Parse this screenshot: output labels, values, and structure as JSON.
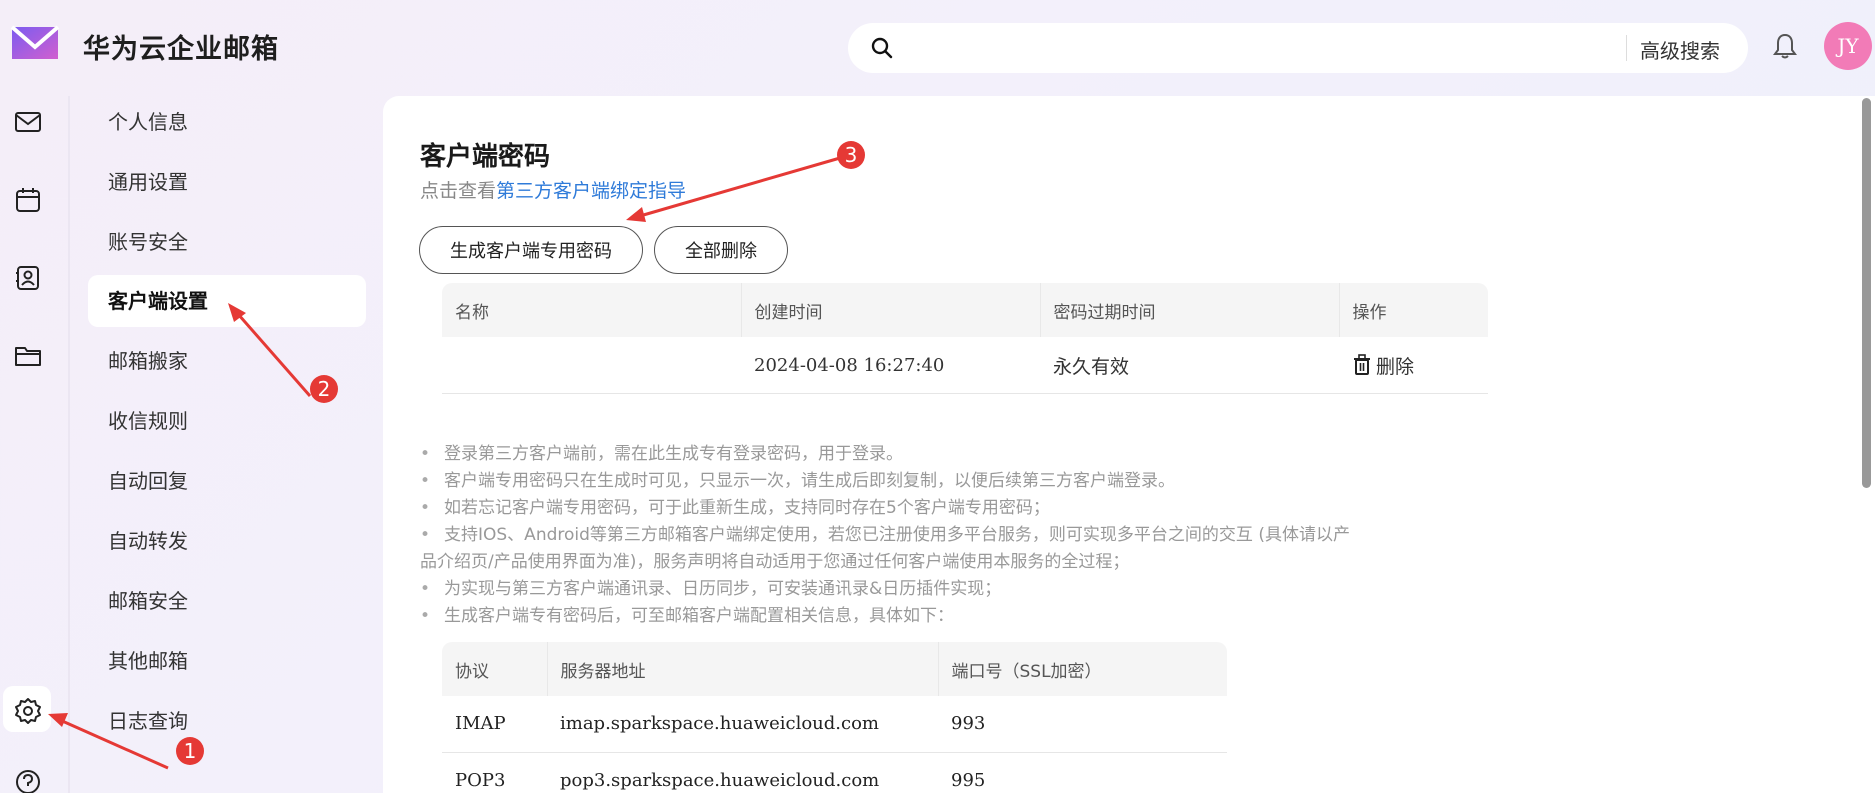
{
  "app": {
    "title": "华为云企业邮箱"
  },
  "search": {
    "placeholder": "",
    "advanced_label": "高级搜索"
  },
  "user": {
    "avatar_initials": "JY"
  },
  "menu": {
    "items": [
      {
        "label": "个人信息"
      },
      {
        "label": "通用设置"
      },
      {
        "label": "账号安全"
      },
      {
        "label": "客户端设置"
      },
      {
        "label": "邮箱搬家"
      },
      {
        "label": "收信规则"
      },
      {
        "label": "自动回复"
      },
      {
        "label": "自动转发"
      },
      {
        "label": "邮箱安全"
      },
      {
        "label": "其他邮箱"
      },
      {
        "label": "日志查询"
      }
    ],
    "active": "客户端设置"
  },
  "main": {
    "title": "客户端密码",
    "subtitle_prefix": "点击查看",
    "subtitle_link": "第三方客户端绑定指导",
    "btn_generate": "生成客户端专用密码",
    "btn_delete_all": "全部删除",
    "pw_table": {
      "headers": [
        "名称",
        "创建时间",
        "密码过期时间",
        "操作"
      ],
      "rows": [
        {
          "name": "",
          "created": "2024-04-08 16:27:40",
          "expires": "永久有效",
          "action": "删除"
        }
      ]
    },
    "notes": [
      "登录第三方客户端前，需在此生成专有登录密码，用于登录。",
      "客户端专用密码只在生成时可见，只显示一次，请生成后即刻复制，以便后续第三方客户端登录。",
      "如若忘记客户端专用密码，可于此重新生成，支持同时存在5个客户端专用密码；",
      "支持IOS、Android等第三方邮箱客户端绑定使用，若您已注册使用多平台服务，则可实现多平台之间的交互 (具体请以产",
      "品介绍页/产品使用界面为准)，服务声明将自动适用于您通过任何客户端使用本服务的全过程；",
      "为实现与第三方客户端通讯录、日历同步，可安装通讯录&日历插件实现；",
      "生成客户端专有密码后，可至邮箱客户端配置相关信息，具体如下："
    ],
    "srv_table": {
      "headers": [
        "协议",
        "服务器地址",
        "端口号（SSL加密）"
      ],
      "rows": [
        {
          "protocol": "IMAP",
          "host": "imap.sparkspace.huaweicloud.com",
          "port": "993"
        },
        {
          "protocol": "POP3",
          "host": "pop3.sparkspace.huaweicloud.com",
          "port": "995"
        }
      ]
    }
  },
  "annotations": {
    "one": "1",
    "two": "2",
    "three": "3"
  },
  "colors": {
    "accent_link": "#2f7bd9",
    "annotation_red": "#e53935",
    "avatar_bg": "#f27bb7",
    "logo": "#8b5cf6"
  },
  "icons": [
    "logo-icon",
    "search-icon",
    "bell-icon",
    "mail-icon",
    "calendar-icon",
    "contacts-icon",
    "folder-icon",
    "settings-icon",
    "help-icon",
    "trash-icon"
  ]
}
